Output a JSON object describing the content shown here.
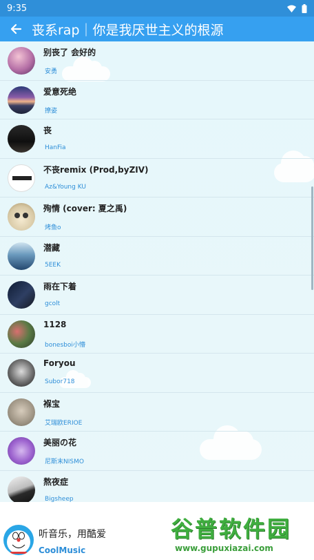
{
  "status_bar": {
    "time": "9:35"
  },
  "app_bar": {
    "title": "丧系rap｜你是我厌世主义的根源"
  },
  "songs": [
    {
      "title": "别丧了 会好的",
      "artist": "安勇"
    },
    {
      "title": "爱意死绝",
      "artist": "撩姿"
    },
    {
      "title": "丧",
      "artist": "HanFia"
    },
    {
      "title": "不丧remix (Prod,byZIV)",
      "artist": "Az&Young KU"
    },
    {
      "title": "殉情 (cover: 夏之禹)",
      "artist": "烤鱼o"
    },
    {
      "title": "潜藏",
      "artist": "5EEK"
    },
    {
      "title": "雨在下着",
      "artist": "gcolt"
    },
    {
      "title": "1128",
      "artist": "bonesboi小懵"
    },
    {
      "title": "Foryou",
      "artist": "Subor718"
    },
    {
      "title": "褓宝",
      "artist": "艾瑞欧ERIOE"
    },
    {
      "title": "美丽の花",
      "artist": "尼斯末NISMO"
    },
    {
      "title": "熬夜症",
      "artist": "Bigsheep"
    }
  ],
  "footer": {
    "slogan": "听音乐，用酷爱",
    "app_name": "CoolMusic"
  },
  "watermark": {
    "cn": "谷普软件园",
    "en": "www.gupuxiazai.com"
  },
  "colors": {
    "status_bar": "#2f8fd9",
    "app_bar": "#36a0f0",
    "artist_text": "#2d8ed8",
    "list_bg": "#e6f7fb"
  },
  "icons": {
    "back": "arrow-left-icon",
    "wifi": "wifi-icon",
    "battery": "battery-icon",
    "app_logo": "doraemon-logo"
  }
}
